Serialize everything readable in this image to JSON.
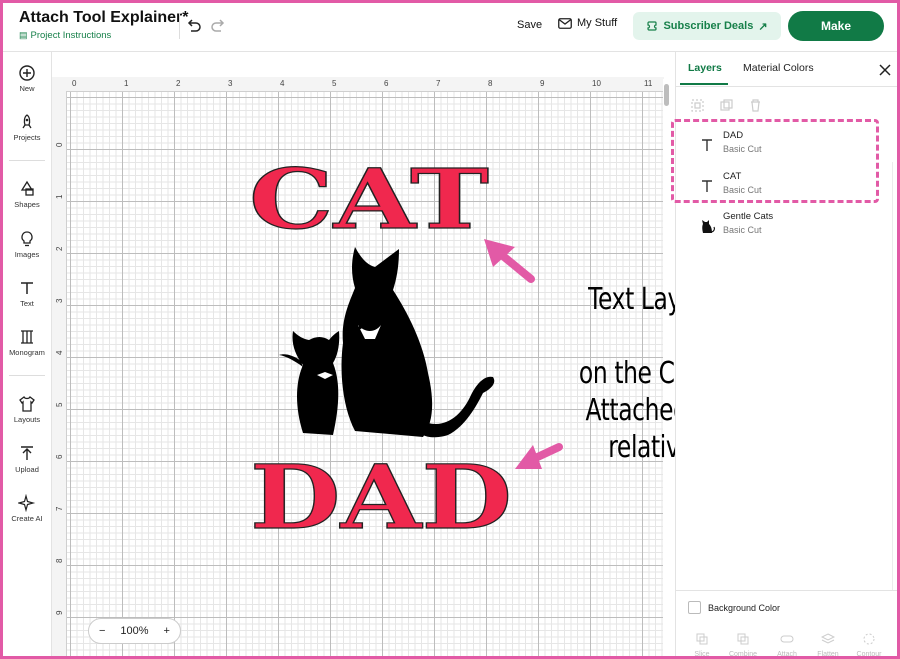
{
  "header": {
    "doc_title": "Attach Tool Explainer*",
    "project_link": "Project Instructions",
    "save_label": "Save",
    "mystuff_label": "My Stuff",
    "deals_label": "Subscriber Deals",
    "make_label": "Make"
  },
  "left_toolbar": {
    "items": [
      {
        "label": "New",
        "icon": "plus-circle-icon"
      },
      {
        "label": "Projects",
        "icon": "rocket-icon"
      },
      {
        "label": "Shapes",
        "icon": "shapes-icon"
      },
      {
        "label": "Images",
        "icon": "lightbulb-icon"
      },
      {
        "label": "Text",
        "icon": "text-t-icon"
      },
      {
        "label": "Monogram",
        "icon": "monogram-icon"
      },
      {
        "label": "Layouts",
        "icon": "shirt-icon"
      },
      {
        "label": "Upload",
        "icon": "upload-icon"
      },
      {
        "label": "Create AI",
        "icon": "sparkle-icon"
      }
    ]
  },
  "canvas": {
    "ruler_top": [
      "0",
      "1",
      "2",
      "3",
      "4",
      "5",
      "6",
      "7",
      "8",
      "9",
      "10",
      "11"
    ],
    "ruler_left": [
      "0",
      "1",
      "2",
      "3",
      "4",
      "5",
      "6",
      "7",
      "8",
      "9",
      "10"
    ],
    "art_top_text": "CAT",
    "art_bottom_text": "DAD",
    "zoom": {
      "minus": "−",
      "level": "100%",
      "plus": "+"
    }
  },
  "callout": {
    "lines": [
      "Text Layers are lined up",
      "on the Canvas but not",
      "Attached to maintain",
      "relative positions"
    ],
    "color": "#e25aa6"
  },
  "panel": {
    "tab_layers": "Layers",
    "tab_colors": "Material Colors",
    "layers": [
      {
        "name": "DAD",
        "sub": "Basic Cut",
        "icon": "text-t-icon"
      },
      {
        "name": "CAT",
        "sub": "Basic Cut",
        "icon": "text-t-icon"
      },
      {
        "name": "Gentle Cats",
        "sub": "Basic Cut",
        "icon": "cat-icon"
      }
    ],
    "background_color_label": "Background Color",
    "bottom_tools": [
      "Slice",
      "Combine",
      "Attach",
      "Flatten",
      "Contour"
    ]
  },
  "colors": {
    "accent_green": "#117a46",
    "text_red": "#f0284e",
    "highlight_pink": "#e25aa6"
  }
}
